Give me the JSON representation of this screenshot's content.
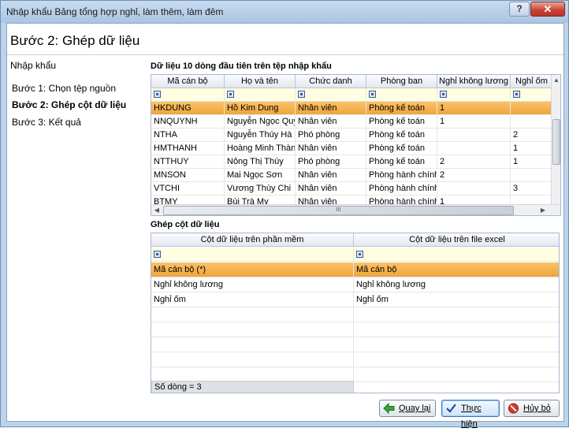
{
  "window": {
    "title": "Nhập khẩu Bảng tổng hợp nghỉ, làm thêm, làm đêm",
    "help_label": "?",
    "close_label": "✕"
  },
  "step_title": "Bước 2: Ghép dữ liệu",
  "left_panel": {
    "heading": "Nhập khẩu",
    "steps": [
      {
        "label": "Bước 1: Chọn tệp nguồn",
        "active": false
      },
      {
        "label": "Bước 2: Ghép cột dữ liệu",
        "active": true
      },
      {
        "label": "Bước 3: Kết quả",
        "active": false
      }
    ]
  },
  "preview": {
    "title": "Dữ liệu 10 dòng đầu tiên trên tệp nhập khẩu",
    "columns": [
      "Mã cán bộ",
      "Họ và tên",
      "Chức danh",
      "Phòng ban",
      "Nghỉ không lương",
      "Nghỉ ốm"
    ],
    "rows": [
      [
        "HKDUNG",
        "Hồ Kim Dung",
        "Nhân viên",
        "Phòng kế toán",
        "1",
        ""
      ],
      [
        "NNQUYNH",
        "Nguyễn Ngọc Quỳnh",
        "Nhân viên",
        "Phòng kế toán",
        "1",
        ""
      ],
      [
        "NTHA",
        "Nguyễn Thúy Hà",
        "Phó phòng",
        "Phòng kế toán",
        "",
        "2"
      ],
      [
        "HMTHANH",
        "Hoàng Minh Thành",
        "Nhân viên",
        "Phòng kế toán",
        "",
        "1"
      ],
      [
        "NTTHUY",
        "Nông Thị Thúy",
        "Phó phòng",
        "Phòng kế toán",
        "2",
        "1"
      ],
      [
        "MNSON",
        "Mai Ngọc Sơn",
        "Nhân viên",
        "Phòng hành chính",
        "2",
        ""
      ],
      [
        "VTCHI",
        "Vương Thùy Chi",
        "Nhân viên",
        "Phòng hành chính",
        "",
        "3"
      ],
      [
        "BTMY",
        "Bùi Trà My",
        "Nhân viên",
        "Phòng hành chính",
        "1",
        ""
      ]
    ],
    "hscroll_grip": "III"
  },
  "mapping": {
    "title": "Ghép cột dữ liệu",
    "columns": [
      "Cột dữ liệu trên phần mềm",
      "Cột dữ liệu trên file excel"
    ],
    "rows": [
      [
        "Mã cán bộ (*)",
        "Mã cán bộ"
      ],
      [
        "Nghỉ không lương",
        "Nghỉ không lương"
      ],
      [
        "Nghỉ ốm",
        "Nghỉ ốm"
      ]
    ],
    "row_count": "Số dòng = 3"
  },
  "buttons": {
    "back": "Quay lại",
    "execute": "Thực hiện",
    "cancel": "Hủy bỏ"
  },
  "colors": {
    "selected_row": "#f0a43a",
    "filter_row": "#fffee0",
    "window_frame": "#bcd3ea"
  }
}
